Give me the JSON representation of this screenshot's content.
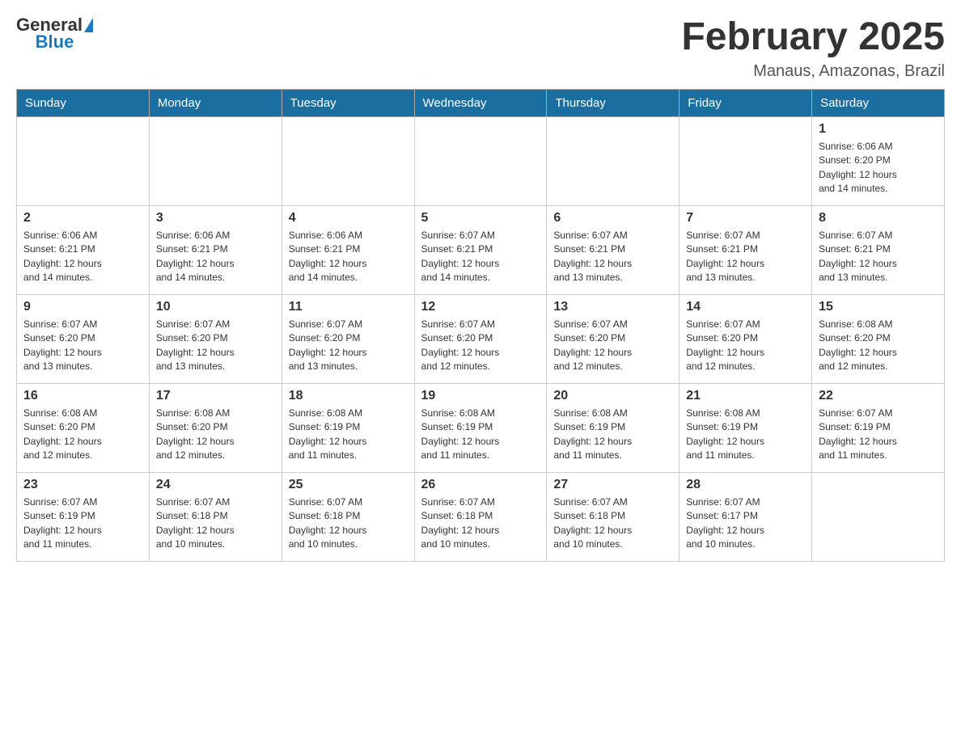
{
  "header": {
    "logo_general": "General",
    "logo_blue": "Blue",
    "month_title": "February 2025",
    "location": "Manaus, Amazonas, Brazil"
  },
  "days_of_week": [
    "Sunday",
    "Monday",
    "Tuesday",
    "Wednesday",
    "Thursday",
    "Friday",
    "Saturday"
  ],
  "weeks": [
    [
      {
        "day": "",
        "info": ""
      },
      {
        "day": "",
        "info": ""
      },
      {
        "day": "",
        "info": ""
      },
      {
        "day": "",
        "info": ""
      },
      {
        "day": "",
        "info": ""
      },
      {
        "day": "",
        "info": ""
      },
      {
        "day": "1",
        "info": "Sunrise: 6:06 AM\nSunset: 6:20 PM\nDaylight: 12 hours\nand 14 minutes."
      }
    ],
    [
      {
        "day": "2",
        "info": "Sunrise: 6:06 AM\nSunset: 6:21 PM\nDaylight: 12 hours\nand 14 minutes."
      },
      {
        "day": "3",
        "info": "Sunrise: 6:06 AM\nSunset: 6:21 PM\nDaylight: 12 hours\nand 14 minutes."
      },
      {
        "day": "4",
        "info": "Sunrise: 6:06 AM\nSunset: 6:21 PM\nDaylight: 12 hours\nand 14 minutes."
      },
      {
        "day": "5",
        "info": "Sunrise: 6:07 AM\nSunset: 6:21 PM\nDaylight: 12 hours\nand 14 minutes."
      },
      {
        "day": "6",
        "info": "Sunrise: 6:07 AM\nSunset: 6:21 PM\nDaylight: 12 hours\nand 13 minutes."
      },
      {
        "day": "7",
        "info": "Sunrise: 6:07 AM\nSunset: 6:21 PM\nDaylight: 12 hours\nand 13 minutes."
      },
      {
        "day": "8",
        "info": "Sunrise: 6:07 AM\nSunset: 6:21 PM\nDaylight: 12 hours\nand 13 minutes."
      }
    ],
    [
      {
        "day": "9",
        "info": "Sunrise: 6:07 AM\nSunset: 6:20 PM\nDaylight: 12 hours\nand 13 minutes."
      },
      {
        "day": "10",
        "info": "Sunrise: 6:07 AM\nSunset: 6:20 PM\nDaylight: 12 hours\nand 13 minutes."
      },
      {
        "day": "11",
        "info": "Sunrise: 6:07 AM\nSunset: 6:20 PM\nDaylight: 12 hours\nand 13 minutes."
      },
      {
        "day": "12",
        "info": "Sunrise: 6:07 AM\nSunset: 6:20 PM\nDaylight: 12 hours\nand 12 minutes."
      },
      {
        "day": "13",
        "info": "Sunrise: 6:07 AM\nSunset: 6:20 PM\nDaylight: 12 hours\nand 12 minutes."
      },
      {
        "day": "14",
        "info": "Sunrise: 6:07 AM\nSunset: 6:20 PM\nDaylight: 12 hours\nand 12 minutes."
      },
      {
        "day": "15",
        "info": "Sunrise: 6:08 AM\nSunset: 6:20 PM\nDaylight: 12 hours\nand 12 minutes."
      }
    ],
    [
      {
        "day": "16",
        "info": "Sunrise: 6:08 AM\nSunset: 6:20 PM\nDaylight: 12 hours\nand 12 minutes."
      },
      {
        "day": "17",
        "info": "Sunrise: 6:08 AM\nSunset: 6:20 PM\nDaylight: 12 hours\nand 12 minutes."
      },
      {
        "day": "18",
        "info": "Sunrise: 6:08 AM\nSunset: 6:19 PM\nDaylight: 12 hours\nand 11 minutes."
      },
      {
        "day": "19",
        "info": "Sunrise: 6:08 AM\nSunset: 6:19 PM\nDaylight: 12 hours\nand 11 minutes."
      },
      {
        "day": "20",
        "info": "Sunrise: 6:08 AM\nSunset: 6:19 PM\nDaylight: 12 hours\nand 11 minutes."
      },
      {
        "day": "21",
        "info": "Sunrise: 6:08 AM\nSunset: 6:19 PM\nDaylight: 12 hours\nand 11 minutes."
      },
      {
        "day": "22",
        "info": "Sunrise: 6:07 AM\nSunset: 6:19 PM\nDaylight: 12 hours\nand 11 minutes."
      }
    ],
    [
      {
        "day": "23",
        "info": "Sunrise: 6:07 AM\nSunset: 6:19 PM\nDaylight: 12 hours\nand 11 minutes."
      },
      {
        "day": "24",
        "info": "Sunrise: 6:07 AM\nSunset: 6:18 PM\nDaylight: 12 hours\nand 10 minutes."
      },
      {
        "day": "25",
        "info": "Sunrise: 6:07 AM\nSunset: 6:18 PM\nDaylight: 12 hours\nand 10 minutes."
      },
      {
        "day": "26",
        "info": "Sunrise: 6:07 AM\nSunset: 6:18 PM\nDaylight: 12 hours\nand 10 minutes."
      },
      {
        "day": "27",
        "info": "Sunrise: 6:07 AM\nSunset: 6:18 PM\nDaylight: 12 hours\nand 10 minutes."
      },
      {
        "day": "28",
        "info": "Sunrise: 6:07 AM\nSunset: 6:17 PM\nDaylight: 12 hours\nand 10 minutes."
      },
      {
        "day": "",
        "info": ""
      }
    ]
  ]
}
